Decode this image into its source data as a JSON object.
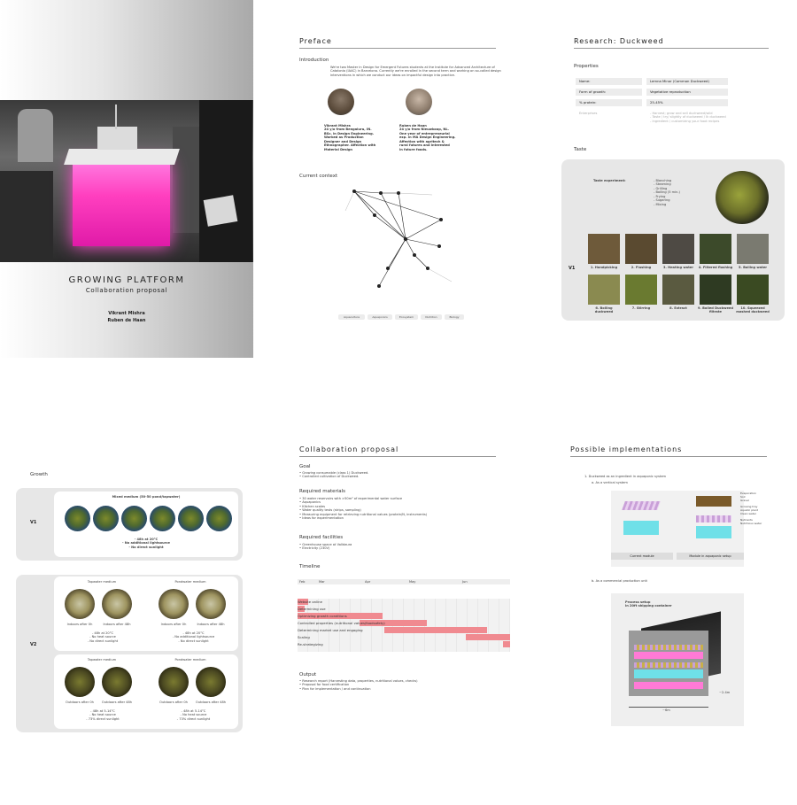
{
  "cover": {
    "title": "GROWING PLATFORM",
    "subtitle": "Collaboration proposal",
    "author1": "Vikrant Mishra",
    "author2": "Ruben de Haan"
  },
  "preface": {
    "title": "Preface",
    "intro_heading": "Introduction",
    "intro_text": "We're two Master in Design for Emergent Futures students at the Institute for Advanced Architecture of Catalonia (IAAC) in Barcelona. Currently we're enrolled in the second term and working on so-called design interventions in which we conduct our ideas on impactful design into practice.",
    "person1": "Vikrant Mishra\n24 y/o from Bengaluru, IN.\nBSc. in Design Engineering.\nWorked as Production\nDesigner and Design\nEthnographer. Affection with\nMaterial Design",
    "person2": "Ruben de Haan\n24 y/o from Nieuwkoop, NL.\nOne year of entrepreneurial\nexp. in MA Design Engineering.\nAffection with agritech &\nrural futures and interested\nin future foods.",
    "context_heading": "Current context",
    "pills": [
      "Aquaculture",
      "Aquaponics",
      "Ecosystem",
      "Nutrition",
      "Biology"
    ]
  },
  "research": {
    "title": "Research: Duckweed",
    "properties_heading": "Properties",
    "rows": [
      {
        "k": "Name:",
        "v": "Lemna Minor (Common Duckweed)"
      },
      {
        "k": "Form of growth:",
        "v": "Vegetative reproduction"
      },
      {
        "k": "% protein:",
        "v": "25-45%"
      }
    ],
    "extra_k": "Enterprises",
    "extra_v": "- Harvest; grow and sell duckweed/wild\n- Taste / try/ slightly of duckweed / Ik duckweed\n- ingredient / customizing your food recipes",
    "taste_heading": "Taste",
    "taste_label": "Taste experiment:",
    "taste_list": "- Blanching\n- Steaming\n- Grilling\n- Boiling (5 min.)\n- Frying\n- Sugaring\n- Mixing",
    "version": "V1",
    "captions": [
      "1. Handpicking",
      "2. Flushing",
      "3. Heating water",
      "4. Filtered flushing",
      "5. Boiling water",
      "6. Boiling duckweed",
      "7. Stirring",
      "8. Extract",
      "9. Boiled Duckweed filtrate",
      "10. Squeezed mashed duckweed"
    ]
  },
  "growth": {
    "title": "Growth",
    "v1": "V1",
    "v1_header": "Mixed medium (50-50 pond/tapwater)",
    "v1_note": "- 48h at 20°C\n- No additional lightsource\n- No direct sunlight",
    "v2": "V2",
    "tap": "Tapwater medium",
    "pond": "Pondwater medium",
    "cap_in0": "Indoors after 0h",
    "cap_in48": "Indoors after 48h",
    "note_in_a": "- 48h at 20°C\n- No heat source\n- No direct sunlight",
    "note_in_b": "- 48h at 20°C\n- No additional lightsource\n- No direct sunlight",
    "cap_out0": "Outdoors after 0h",
    "cap_out48": "Outdoors after 48h",
    "note_out_a": "- 48h at 5-14°C\n- No heat source\n- 73% direct sunlight",
    "note_out_b": "- 48h at 5-14°C\n- No heat source\n- 73% direct sunlight"
  },
  "proposal": {
    "title": "Collaboration proposal",
    "goal_heading": "Goal",
    "goal": "• Growing consumable (class 1) Duckweed.\n• Controlled cultivation of Duckweed.",
    "materials_heading": "Required materials",
    "materials": "• 30 water reservoirs with >50m² of experimental water surface\n• Aquaponics\n• Kitchen scales\n• Water quality tests (strips, sampling)\n• Measuring equipment for retrieving nutritional values (protein/N, instruments)\n• Ideas for experimentation",
    "facilities_heading": "Required facilities",
    "facilities": "• Greenhouse space at Valldaura\n• Electricity (230V)",
    "timeline_heading": "Timeline",
    "months": [
      "Feb",
      "Mar",
      "Apr",
      "May",
      "Jun"
    ],
    "tasks": [
      "Website online",
      "Determining use",
      "Optimizing growth conditions",
      "Controlled properties (nutritional values/foodsafety)",
      "Determining market use and engaging",
      "Scaling",
      "Re-strategizing"
    ],
    "output_heading": "Output",
    "output": "• Research report (Harvesting data, properties, nutritional values, checks)\n• Proposal for food certification\n• Plan for implementation / and continuation"
  },
  "impl": {
    "title": "Possible implementations",
    "intro": "1. Duckweed as an ingredient in aquaponic system",
    "a": "a. As a vertical system",
    "b": "b. As a commercial production unit",
    "cap_left": "Current module",
    "cap_right": "Module in aquaponic setup",
    "labels": "Evaporation\nSoil\nGravel\n\nGrowing tray\nAquatic plant\nClean water\n\nNutrients\nNutritious water",
    "box_title": "Process setup\nin 20ft shipping container",
    "dim_w": "~6m",
    "dim_d": "~2.4m"
  },
  "colors": {
    "pink": "#ff3fbf",
    "bar": "#f08a90",
    "panel": "#e7e7e7"
  }
}
